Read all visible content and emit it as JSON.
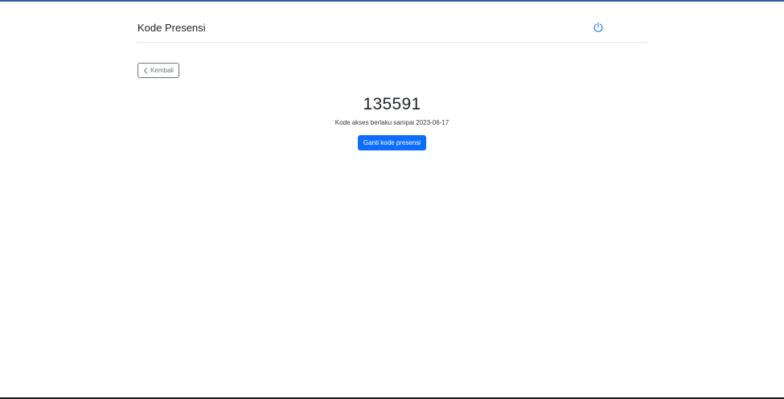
{
  "header": {
    "title": "Kode Presensi",
    "logout_icon": "power-icon"
  },
  "nav": {
    "back_label": "Kembali",
    "back_icon": "chevron-left-icon"
  },
  "main": {
    "code": "135591",
    "validity_text": "Kode akses berlaku sampai 2023-06-17",
    "change_button_label": "Ganti kode presensi"
  },
  "colors": {
    "primary": "#0d6efd",
    "secondary": "#6c757d",
    "top_accent": "#2f5f9e"
  }
}
